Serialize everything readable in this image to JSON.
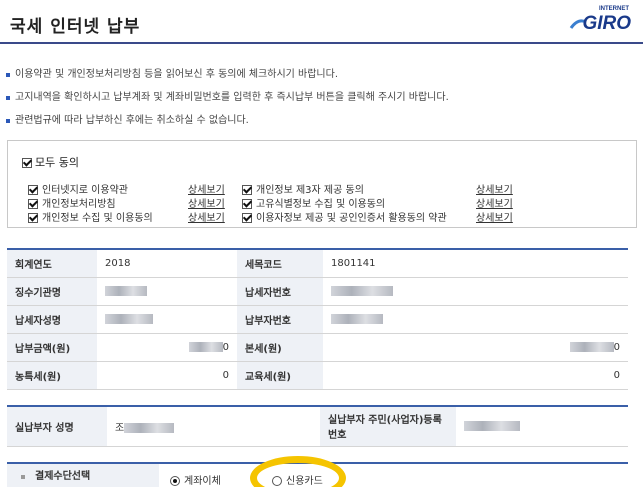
{
  "header": {
    "title": "국세 인터넷 납부",
    "logo_small": "INTERNET",
    "logo_main": "GIRO"
  },
  "notices": [
    "이용약관 및 개인정보처리방침 등을 읽어보신 후 동의에 체크하시기 바랍니다.",
    "고지내역을 확인하시고 납부계좌 및 계좌비밀번호를 입력한 후 즉시납부 버튼을 클릭해 주시기 바랍니다.",
    "관련법규에 따라 납부하신 후에는 취소하실 수 없습니다."
  ],
  "agreements": {
    "all_label": "모두 동의",
    "all_checked": true,
    "detail_label": "상세보기",
    "left": [
      {
        "label": "인터넷지로 이용약관",
        "checked": true
      },
      {
        "label": "개인정보처리방침",
        "checked": true
      },
      {
        "label": "개인정보 수집 및 이용동의",
        "checked": true
      }
    ],
    "right": [
      {
        "label": "개인정보 제3자 제공 동의",
        "checked": true
      },
      {
        "label": "고유식별정보 수집 및 이용동의",
        "checked": true
      },
      {
        "label": "이용자정보 제공 및 공인인증서 활용동의 약관",
        "checked": true
      }
    ]
  },
  "tax_info": {
    "fiscal_year_label": "회계연도",
    "fiscal_year_value": "2018",
    "tax_code_label": "세목코드",
    "tax_code_value": "1801141",
    "collector_label": "징수기관명",
    "taxpayer_no_label": "납세자번호",
    "taxpayer_name_label": "납세자성명",
    "payment_no_label": "납부자번호",
    "amount_label": "납부금액(원)",
    "amount_suffix": "0",
    "principal_label": "본세(원)",
    "principal_suffix": "0",
    "rural_tax_label": "농특세(원)",
    "rural_tax_value": "0",
    "edu_tax_label": "교육세(원)",
    "edu_tax_value": "0"
  },
  "payer": {
    "name_label": "실납부자 성명",
    "name_prefix": "조",
    "id_label": "실납부자 주민(사업자)등록번호"
  },
  "payment_method": {
    "label": "결제수단선택",
    "options": [
      {
        "label": "계좌이체",
        "selected": true
      },
      {
        "label": "신용카드",
        "selected": false
      }
    ]
  },
  "colors": {
    "accent_blue": "#3a5fa8",
    "label_bg": "#eef1f6",
    "highlight": "#f5c400"
  }
}
